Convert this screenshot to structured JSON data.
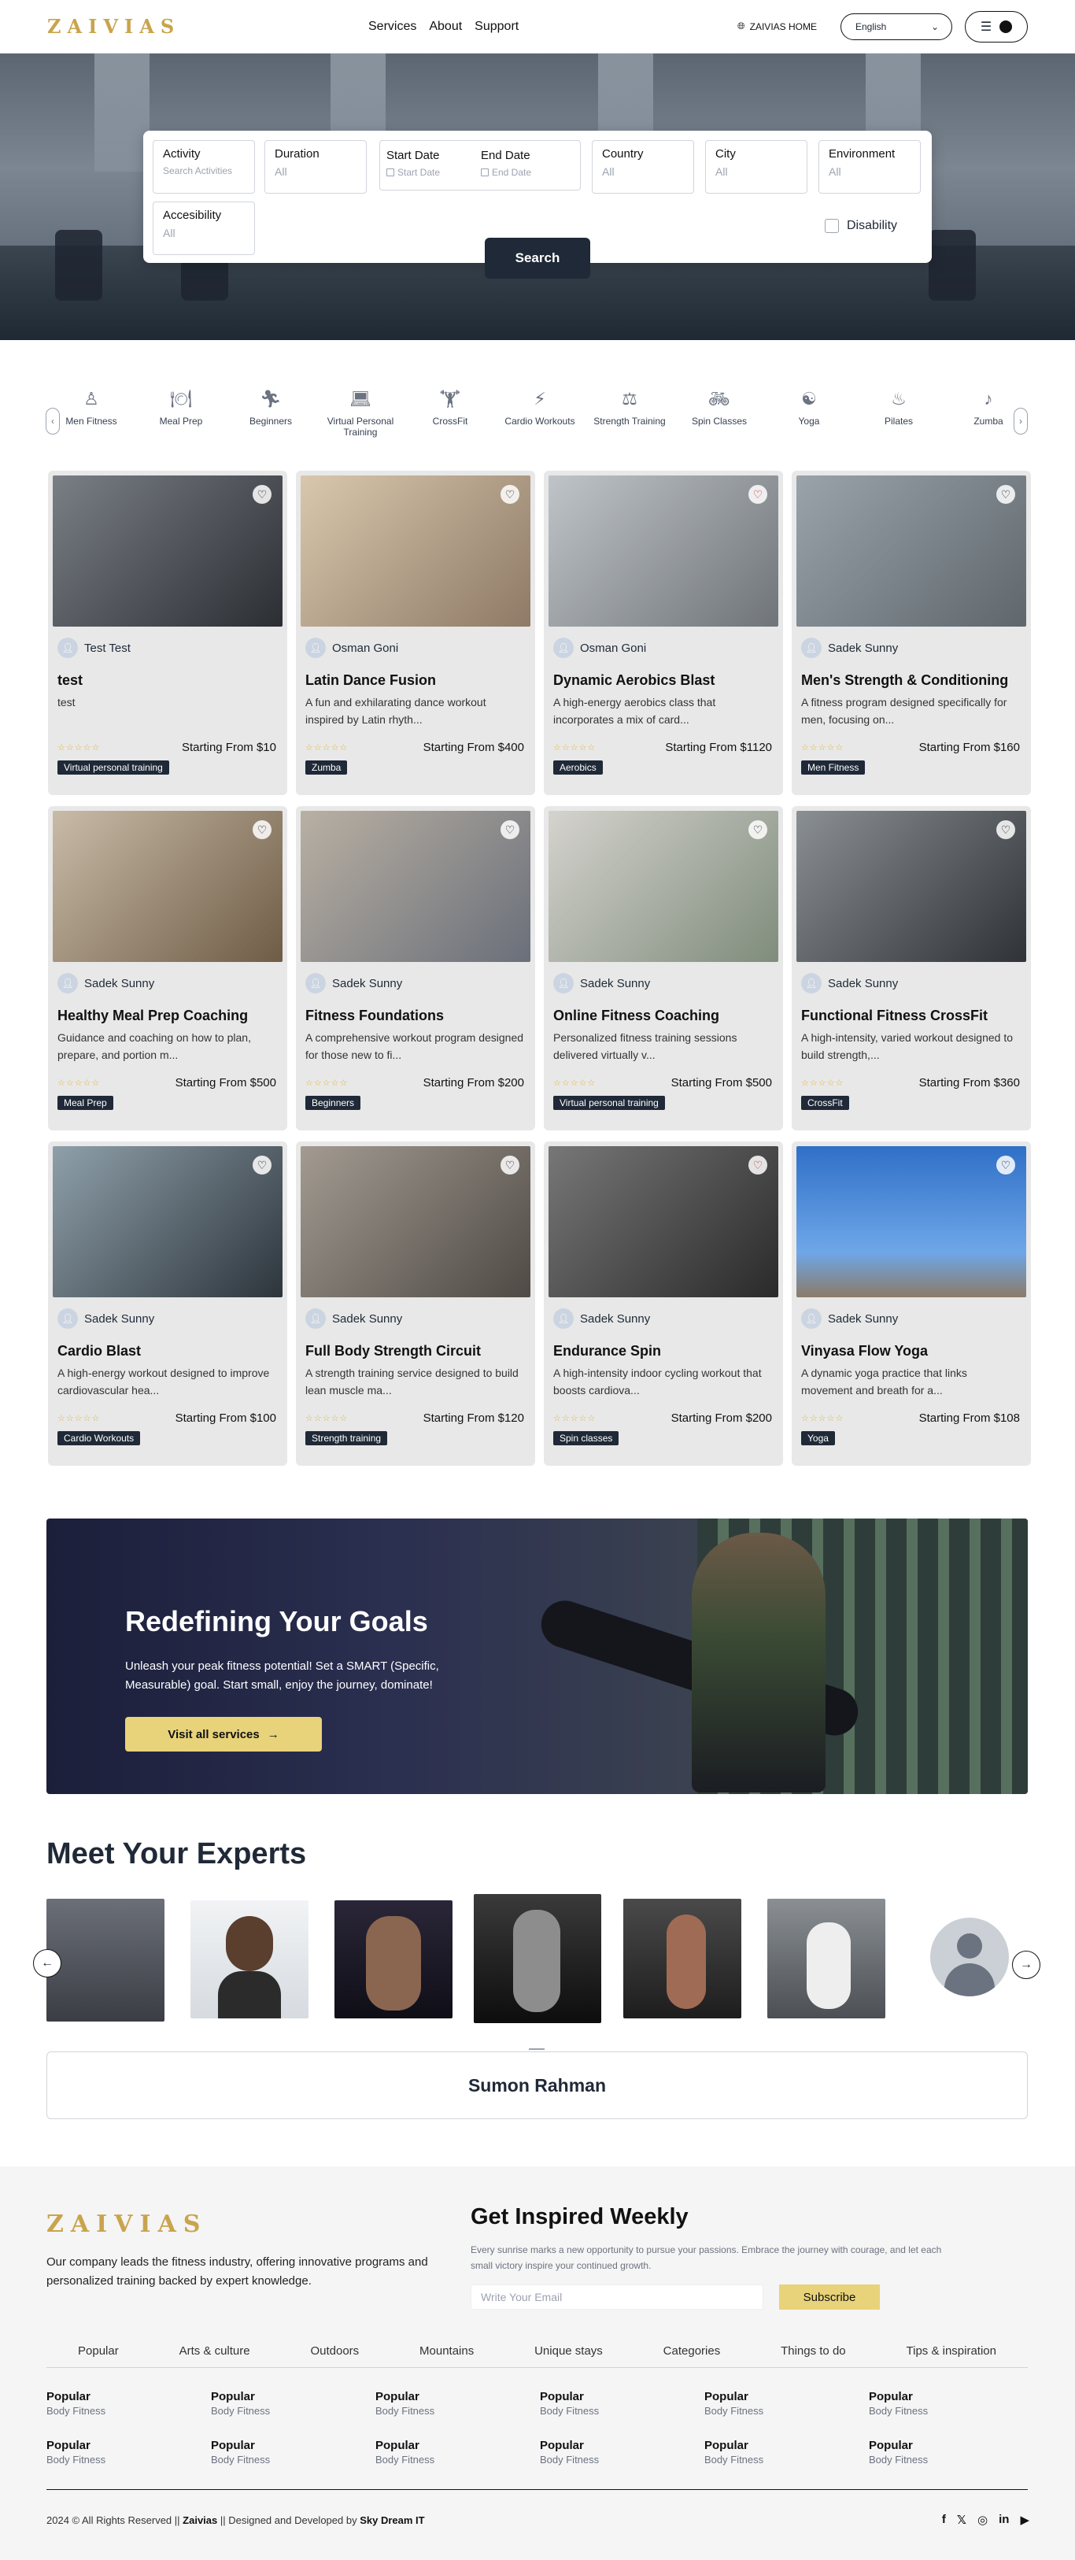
{
  "header": {
    "logo": "ZAIVIAS",
    "nav": [
      "Services",
      "About",
      "Support"
    ],
    "home_link": "ZAIVIAS HOME",
    "language": "English"
  },
  "search": {
    "activity": {
      "label": "Activity",
      "placeholder": "Search Activities"
    },
    "duration": {
      "label": "Duration",
      "value": "All"
    },
    "start_date": {
      "label": "Start Date",
      "placeholder": "Start Date"
    },
    "end_date": {
      "label": "End Date",
      "placeholder": "End Date"
    },
    "country": {
      "label": "Country",
      "value": "All"
    },
    "city": {
      "label": "City",
      "value": "All"
    },
    "environment": {
      "label": "Environment",
      "value": "All"
    },
    "accessibility": {
      "label": "Accesibility",
      "value": "All"
    },
    "disability_label": "Disability",
    "button": "Search"
  },
  "categories": [
    "Men Fitness",
    "Meal Prep",
    "Beginners",
    "Virtual Personal Training",
    "CrossFit",
    "Cardio Workouts",
    "Strength Training",
    "Spin Classes",
    "Yoga",
    "Pilates",
    "Zumba"
  ],
  "cards": [
    {
      "author": "Test Test",
      "title": "test",
      "desc": "test",
      "price": "Starting From $10",
      "tag": "Virtual personal training"
    },
    {
      "author": "Osman Goni",
      "title": "Latin Dance Fusion",
      "desc": "A fun and exhilarating dance workout inspired by Latin rhyth...",
      "price": "Starting From $400",
      "tag": "Zumba"
    },
    {
      "author": "Osman Goni",
      "title": "Dynamic Aerobics Blast",
      "desc": "A high-energy aerobics class that incorporates a mix of card...",
      "price": "Starting From $1120",
      "tag": "Aerobics"
    },
    {
      "author": "Sadek Sunny",
      "title": "Men's Strength & Conditioning",
      "desc": "A fitness program designed specifically for men, focusing on...",
      "price": "Starting From $160",
      "tag": "Men Fitness"
    },
    {
      "author": "Sadek Sunny",
      "title": "Healthy Meal Prep Coaching",
      "desc": "Guidance and coaching on how to plan, prepare, and portion m...",
      "price": "Starting From $500",
      "tag": "Meal Prep"
    },
    {
      "author": "Sadek Sunny",
      "title": "Fitness Foundations",
      "desc": "A comprehensive workout program designed for those new to fi...",
      "price": "Starting From $200",
      "tag": "Beginners"
    },
    {
      "author": "Sadek Sunny",
      "title": "Online Fitness Coaching",
      "desc": "Personalized fitness training sessions delivered virtually v...",
      "price": "Starting From $500",
      "tag": "Virtual personal training"
    },
    {
      "author": "Sadek Sunny",
      "title": "Functional Fitness CrossFit",
      "desc": "A high-intensity, varied workout designed to build strength,...",
      "price": "Starting From $360",
      "tag": "CrossFit"
    },
    {
      "author": "Sadek Sunny",
      "title": "Cardio Blast",
      "desc": "A high-energy workout designed to improve cardiovascular hea...",
      "price": "Starting From $100",
      "tag": "Cardio Workouts"
    },
    {
      "author": "Sadek Sunny",
      "title": "Full Body Strength Circuit",
      "desc": "A strength training service designed to build lean muscle ma...",
      "price": "Starting From $120",
      "tag": "Strength training"
    },
    {
      "author": "Sadek Sunny",
      "title": "Endurance Spin",
      "desc": "A high-intensity indoor cycling workout that boosts cardiova...",
      "price": "Starting From $200",
      "tag": "Spin classes"
    },
    {
      "author": "Sadek Sunny",
      "title": "Vinyasa Flow Yoga",
      "desc": "A dynamic yoga practice that links movement and breath for a...",
      "price": "Starting From $108",
      "tag": "Yoga"
    }
  ],
  "banner": {
    "title": "Redefining Your Goals",
    "text": "Unleash your peak fitness potential! Set a SMART (Specific, Measurable) goal. Start small, enjoy the journey, dominate!",
    "button": "Visit all services"
  },
  "experts": {
    "heading": "Meet Your Experts",
    "selected_name": "Sumon Rahman"
  },
  "footer": {
    "logo": "ZAIVIAS",
    "about": "Our company leads the fitness industry, offering innovative programs and personalized training backed by expert knowledge.",
    "newsletter_title": "Get Inspired Weekly",
    "newsletter_text": "Every sunrise marks a new opportunity to pursue your passions. Embrace the journey with courage, and let each small victory inspire your continued growth.",
    "email_placeholder": "Write Your Email",
    "subscribe": "Subscribe",
    "tabs": [
      "Popular",
      "Arts & culture",
      "Outdoors",
      "Mountains",
      "Unique stays",
      "Categories",
      "Things to do",
      "Tips & inspiration"
    ],
    "link_title": "Popular",
    "link_sub": "Body Fitness",
    "copyright_pre": "2024 © All Rights Reserved ||",
    "copyright_brand": "Zaivias",
    "copyright_mid": "|| Designed and Developed by",
    "copyright_dev": "Sky Dream IT"
  }
}
